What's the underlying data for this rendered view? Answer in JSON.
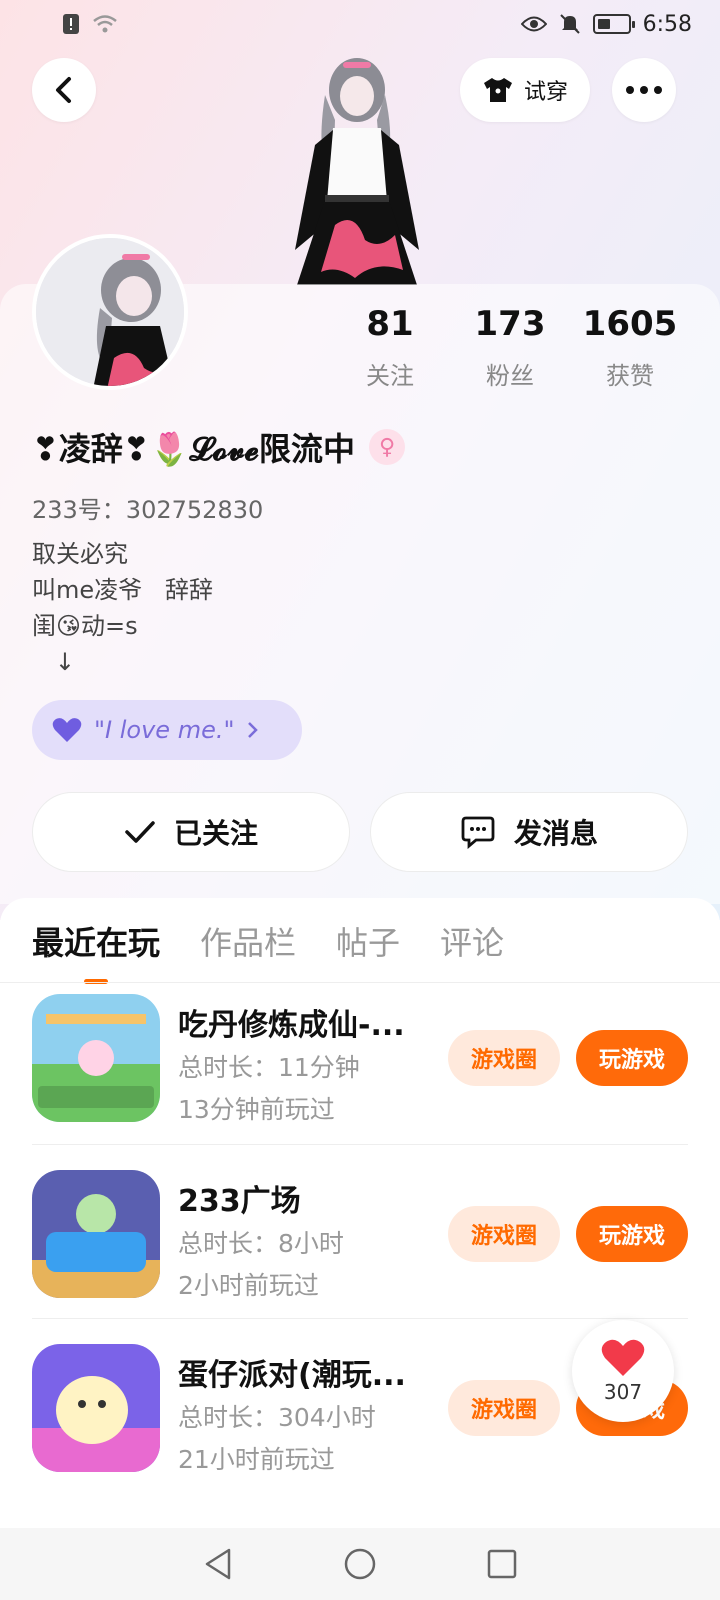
{
  "status_bar": {
    "time": "6:58"
  },
  "header": {
    "try_on_label": "试穿"
  },
  "profile": {
    "stats": [
      {
        "value": "81",
        "label": "关注"
      },
      {
        "value": "173",
        "label": "粉丝"
      },
      {
        "value": "1605",
        "label": "获赞"
      }
    ],
    "nickname": "❣凌辞❣🌷𝓛𝓸𝓿𝓮限流中",
    "uid": "233号：302752830",
    "bio": [
      "取关必究",
      "叫me凌爷   辞辞",
      "闺😘动=s",
      "   ↓"
    ],
    "tag_text": "\"I love me.\"",
    "follow_button": "已关注",
    "message_button": "发消息"
  },
  "tabs": [
    {
      "label": "最近在玩"
    },
    {
      "label": "作品栏"
    },
    {
      "label": "帖子"
    },
    {
      "label": "评论"
    }
  ],
  "games": [
    {
      "title": "吃丹修炼成仙-...",
      "duration": "总时长：11分钟",
      "last_played": "13分钟前玩过",
      "circle_label": "游戏圈",
      "play_label": "玩游戏"
    },
    {
      "title": "233广场",
      "duration": "总时长：8小时",
      "last_played": "2小时前玩过",
      "circle_label": "游戏圈",
      "play_label": "玩游戏"
    },
    {
      "title": "蛋仔派对(潮玩...",
      "duration": "总时长：304小时",
      "last_played": "21小时前玩过",
      "circle_label": "游戏圈",
      "play_label": "玩游戏"
    }
  ],
  "favorite": {
    "count": "307"
  },
  "colors": {
    "accent": "#ff6a0a",
    "accent_soft": "#ffe9dc",
    "tag_bg": "#e3defa"
  }
}
